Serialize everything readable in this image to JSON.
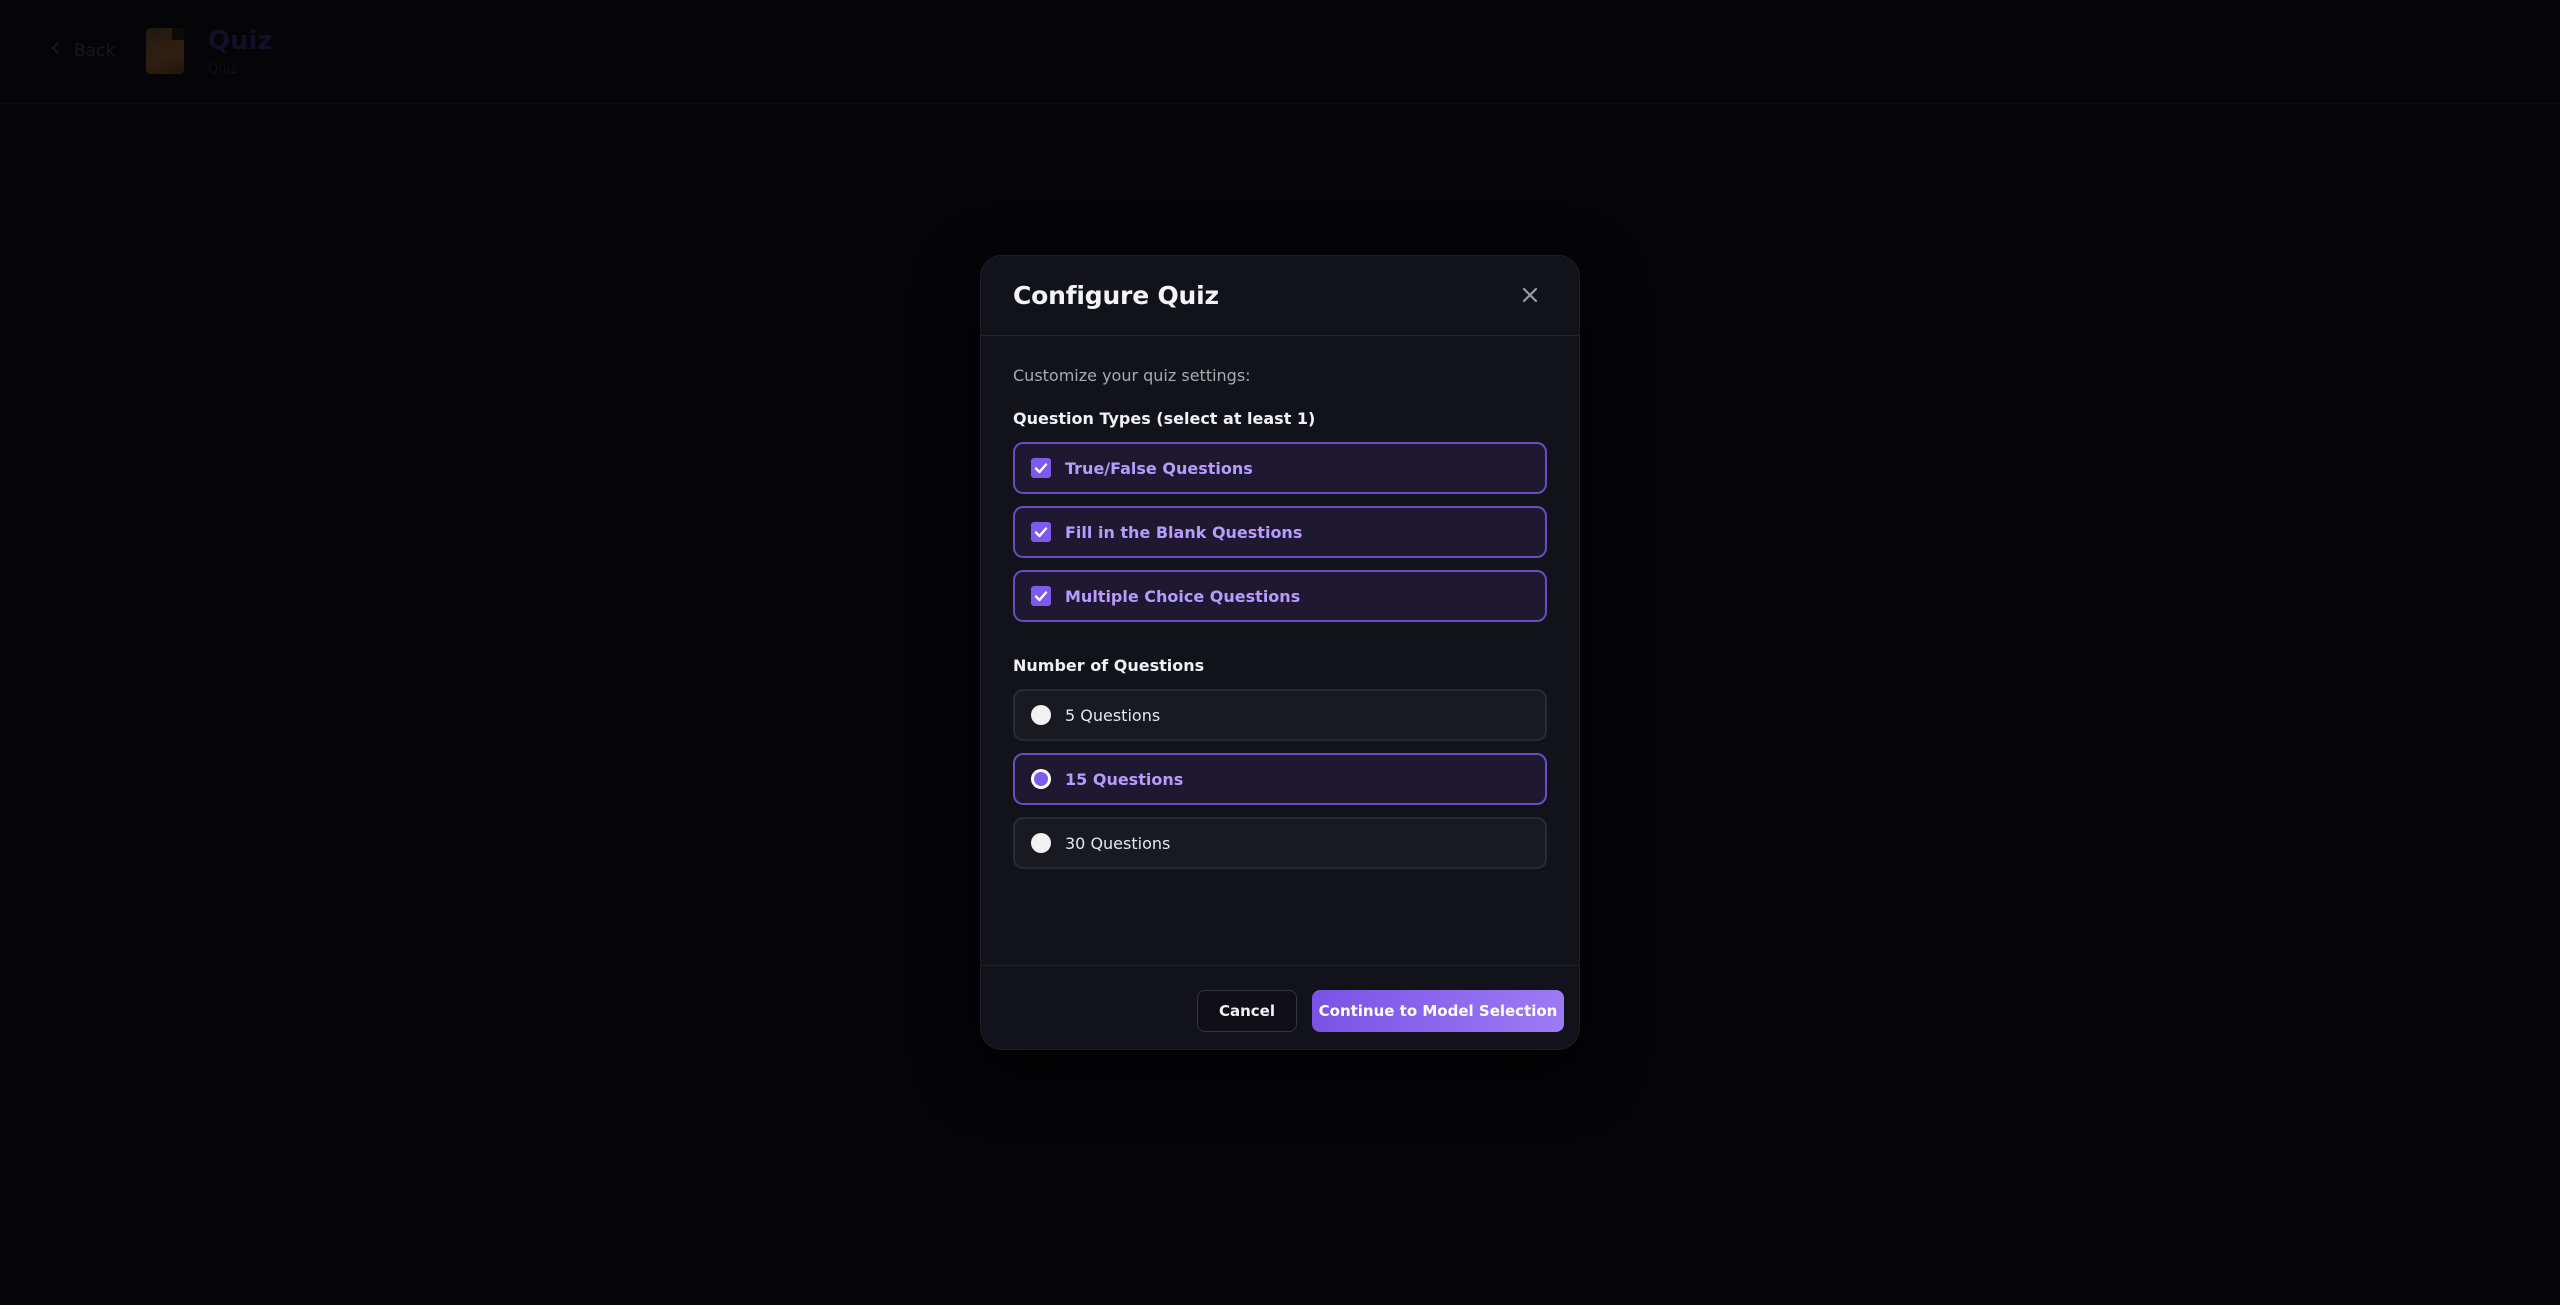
{
  "background": {
    "back_label": "Back",
    "page_title": "Quiz",
    "page_subtitle": "Quiz"
  },
  "modal": {
    "title": "Configure Quiz",
    "intro": "Customize your quiz settings:",
    "question_types": {
      "label": "Question Types (select at least 1)",
      "options": [
        {
          "label": "True/False Questions",
          "checked": true
        },
        {
          "label": "Fill in the Blank Questions",
          "checked": true
        },
        {
          "label": "Multiple Choice Questions",
          "checked": true
        }
      ]
    },
    "question_count": {
      "label": "Number of Questions",
      "options": [
        {
          "label": "5 Questions",
          "selected": false
        },
        {
          "label": "15 Questions",
          "selected": true
        },
        {
          "label": "30 Questions",
          "selected": false
        }
      ]
    },
    "footer": {
      "cancel_label": "Cancel",
      "continue_label": "Continue to Model Selection"
    }
  },
  "colors": {
    "accent": "#7e5bef",
    "accent_text": "#b79bff",
    "modal_bg": "#12121a"
  },
  "icons": {
    "close": "close-icon",
    "check": "check-icon",
    "back": "arrow-left-icon",
    "document": "document-icon"
  }
}
